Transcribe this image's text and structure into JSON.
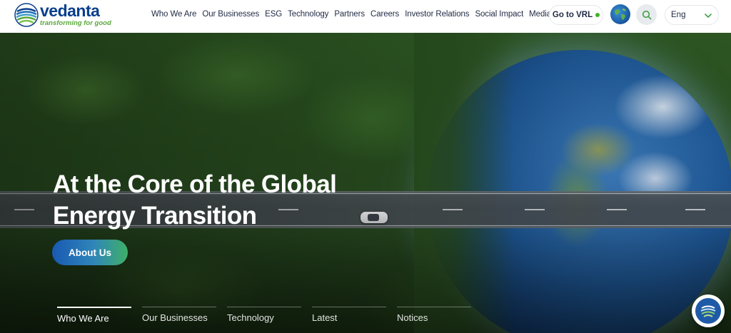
{
  "brand": {
    "name": "vedanta",
    "tagline": "transforming for good",
    "colors": {
      "primary": "#0b3f8c",
      "accent": "#5aa83b"
    }
  },
  "nav": {
    "items": [
      {
        "label": "Who We Are"
      },
      {
        "label": "Our Businesses"
      },
      {
        "label": "ESG"
      },
      {
        "label": "Technology"
      },
      {
        "label": "Partners"
      },
      {
        "label": "Careers"
      },
      {
        "label": "Investor Relations"
      },
      {
        "label": "Social Impact"
      },
      {
        "label": "Media"
      }
    ]
  },
  "header_actions": {
    "goto_label": "Go to VRL",
    "globe_icon": "globe-icon",
    "search_icon": "search-icon",
    "language": {
      "selected": "Eng",
      "chevron_icon": "chevron-down-icon"
    }
  },
  "hero": {
    "title_line1": "At the Core of the Global",
    "title_line2": "Energy Transition",
    "cta_label": "About Us",
    "cta_colors": [
      "#1959b2",
      "#3fb068"
    ]
  },
  "tabs": [
    {
      "label": "Who We Are",
      "active": true
    },
    {
      "label": "Our Businesses",
      "active": false
    },
    {
      "label": "Technology",
      "active": false
    },
    {
      "label": "Latest",
      "active": false
    },
    {
      "label": "Notices",
      "active": false
    }
  ],
  "chat": {
    "icon": "chat-icon"
  }
}
